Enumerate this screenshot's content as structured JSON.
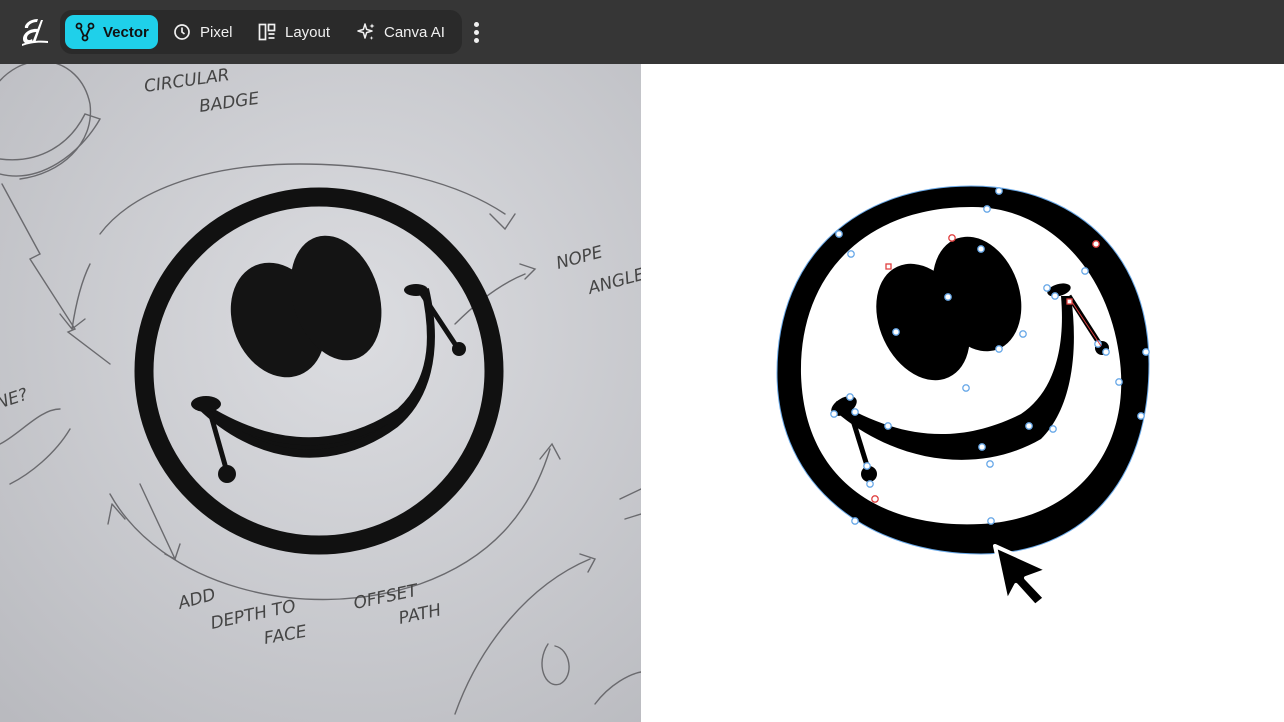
{
  "toolbar": {
    "modes": [
      {
        "label": "Vector",
        "icon": "vector-nodes-icon",
        "active": true
      },
      {
        "label": "Pixel",
        "icon": "pixel-circle-icon",
        "active": false
      },
      {
        "label": "Layout",
        "icon": "layout-grid-icon",
        "active": false
      },
      {
        "label": "Canva AI",
        "icon": "sparkle-icon",
        "active": false
      }
    ],
    "more_icon": "more-vertical-icon",
    "logo_icon": "affinity-logo-icon"
  },
  "sketch": {
    "notes": [
      "CIRCULAR",
      "BADGE",
      "NOPE",
      "ANGLE",
      "ADD",
      "DEPTH TO",
      "FACE",
      "OFFSET",
      "PATH",
      "NE?"
    ]
  },
  "colors": {
    "topbar": "#363636",
    "toolbar": "#2a2a2a",
    "accent": "#1fd0ea",
    "paper": "#cfd0d4",
    "ink": "#000000",
    "node": "#6aa9e8",
    "node_selected": "#e04040"
  }
}
